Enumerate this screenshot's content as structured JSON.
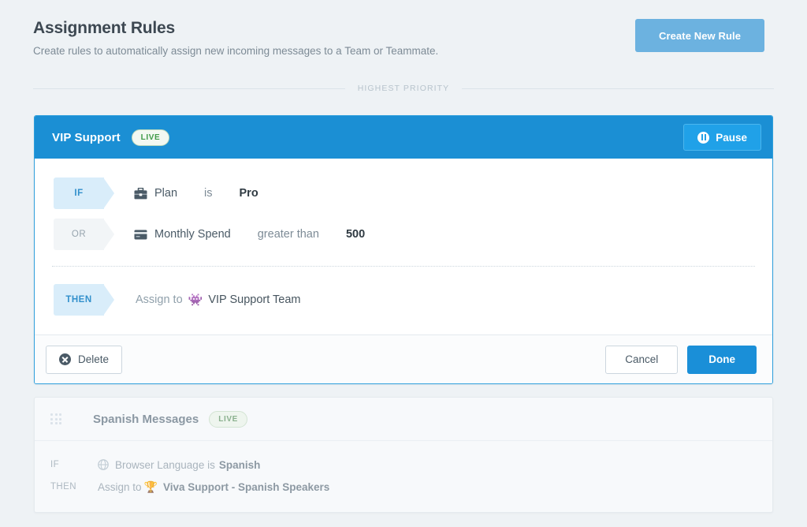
{
  "header": {
    "title": "Assignment Rules",
    "subtitle": "Create rules to automatically assign new incoming messages to a Team or Teammate.",
    "create_button": "Create New Rule"
  },
  "priority_divider": {
    "label": "HIGHEST PRIORITY"
  },
  "active_rule": {
    "name": "VIP Support",
    "status_badge": "LIVE",
    "pause_button": "Pause",
    "pause_icon": "pause-circle-icon",
    "conditions": [
      {
        "tag": "IF",
        "icon": "briefcase-icon",
        "attribute": "Plan",
        "operator": "is",
        "value": "Pro"
      },
      {
        "tag": "OR",
        "icon": "credit-card-icon",
        "attribute": "Monthly Spend",
        "operator": "greater than",
        "value": "500"
      }
    ],
    "action": {
      "tag": "THEN",
      "label": "Assign to",
      "emoji": "👾",
      "emoji_name": "alien-monster-icon",
      "target": "VIP Support Team"
    },
    "footer": {
      "delete": "Delete",
      "delete_icon": "x-circle-icon",
      "cancel": "Cancel",
      "done": "Done"
    }
  },
  "collapsed_rule": {
    "drag_handle_icon": "drag-handle-icon",
    "name": "Spanish Messages",
    "status_badge": "LIVE",
    "rows": [
      {
        "keyword": "IF",
        "icon": "globe-icon",
        "text": "Browser Language is",
        "strong": "Spanish"
      },
      {
        "keyword": "THEN",
        "label": "Assign to",
        "emoji": "🏆",
        "emoji_name": "trophy-icon",
        "strong": "Viva Support - Spanish Speakers"
      }
    ]
  },
  "colors": {
    "page_bg": "#eef2f5",
    "brand_blue": "#1b8fd4",
    "button_blue": "#6cb2e0",
    "done_blue": "#1a8fd8",
    "live_green": "#3f9b48",
    "tag_blue_bg": "#d9edfa",
    "tag_gray_bg": "#f2f5f7"
  }
}
